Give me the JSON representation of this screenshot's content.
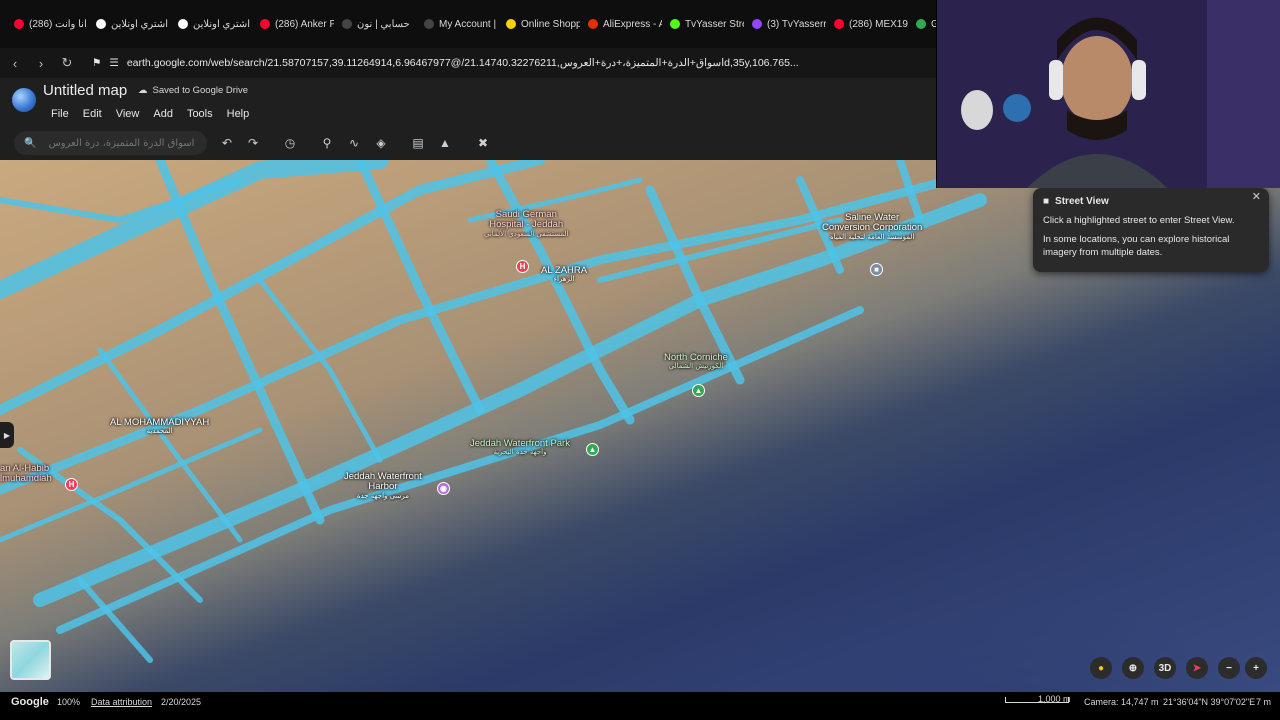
{
  "browser": {
    "tabs": [
      {
        "label": "(286) انا وانت",
        "color": "#ff0033"
      },
      {
        "label": "اشتري اونلاين",
        "color": "#ffffff"
      },
      {
        "label": "اشتري اونلاين",
        "color": "#ffffff"
      },
      {
        "label": "(286) Anker P",
        "color": "#ff0033"
      },
      {
        "label": "حسابي | نون",
        "color": "#444444"
      },
      {
        "label": "My Account |",
        "color": "#444444"
      },
      {
        "label": "Online Shopp",
        "color": "#f5d300"
      },
      {
        "label": "AliExpress - A",
        "color": "#e62e04"
      },
      {
        "label": "TvYasser Stre",
        "color": "#53fc18"
      },
      {
        "label": "(3) TvYasserr",
        "color": "#9146ff"
      },
      {
        "label": "(286) MEX19",
        "color": "#ff0033"
      },
      {
        "label": "Geo",
        "color": "#34a853"
      }
    ],
    "url": "earth.google.com/web/search/21.58707157,39.11264914,6.96467977@/اسواق+الدرة+المتميزة،+درة+العروس,21.14740.32276211d,35y,106.765..."
  },
  "app": {
    "map_title": "Untitled map",
    "saved_status": "Saved to Google Drive",
    "menu": [
      "File",
      "Edit",
      "View",
      "Add",
      "Tools",
      "Help"
    ],
    "search_placeholder": "اسواق الدرة المتميزة، درة العروس"
  },
  "map": {
    "labels": {
      "saudi_german": "Saudi German\nHospital - Jeddah",
      "saudi_german_ar": "المستشفى السعودي الألماني",
      "al_zahra": "AL ZAHRA",
      "al_zahra_ar": "الزهراء",
      "saline": "Saline Water\nConversion Corporation",
      "saline_ar": "المؤسسة العامة لتحلية المياه",
      "north_corniche": "North Corniche",
      "north_corniche_ar": "الكورنيش الشمالي",
      "al_mohammadiyyah": "AL MOHAMMADIYYAH",
      "al_mohammadiyyah_ar": "المحمدية",
      "waterfront_park": "Jeddah Waterfront Park",
      "waterfront_park_ar": "واجهة جدة البحرية",
      "waterfront_harbor": "Jeddah Waterfront\nHarbor",
      "waterfront_harbor_ar": "مرسى واجهة جدة",
      "al_habib": "an Al-Habib\nlmuhamdiah"
    }
  },
  "street_view": {
    "title": "Street View",
    "line1": "Click a highlighted street to enter Street View.",
    "line2": "In some locations, you can explore historical imagery from multiple dates."
  },
  "controls": {
    "three_d": "3D"
  },
  "status": {
    "brand": "Google",
    "zoom": "100%",
    "attribution": "Data attribution",
    "date": "2/20/2025",
    "scale": "1,000 m",
    "camera": "Camera: 14,747 m",
    "coords": "21°36'04\"N 39°07'02\"E",
    "elevation": "7 m"
  },
  "colors": {
    "street_view_overlay": "#4ec3e8",
    "app_bg": "#1f1f1f"
  }
}
